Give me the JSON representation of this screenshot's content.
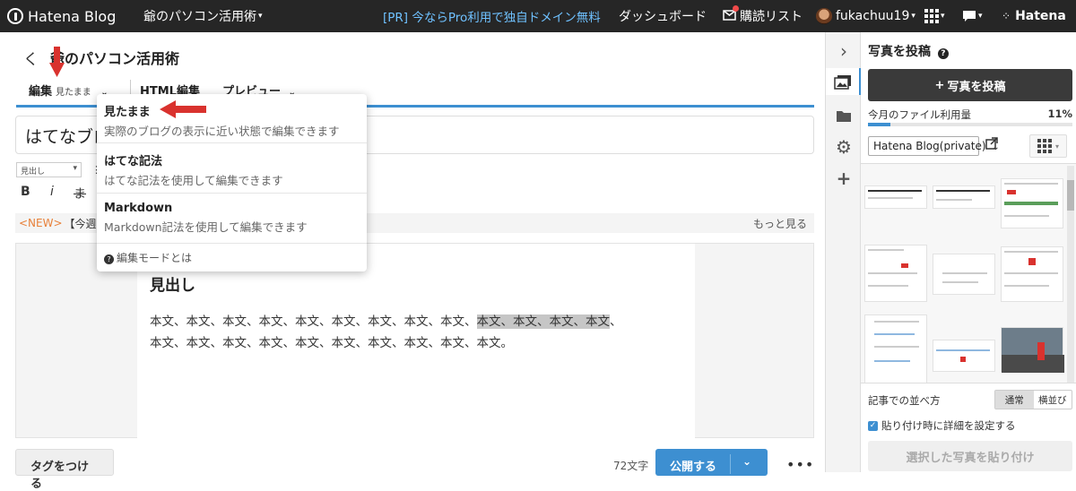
{
  "topbar": {
    "logo": "Hatena Blog",
    "blog_name": "爺のパソコン活用術",
    "pr": "[PR] 今ならPro利用で独自ドメイン無料",
    "dashboard": "ダッシュボード",
    "reading_list": "購読リスト",
    "username": "fukachuu19",
    "hatena": "Hatena",
    "icons": [
      "hatena-logo-icon",
      "reader-icon",
      "avatar",
      "apps-grid-icon",
      "speech-bubble-icon",
      "hatena-star-icon"
    ]
  },
  "editor": {
    "back": "く",
    "blog_title": "爺のパソコン活用術",
    "tabs": {
      "edit": "編集",
      "edit_mode": "見たまま",
      "html": "HTML編集",
      "preview": "プレビュー"
    },
    "title_value": "はてなブロ",
    "toolbar": {
      "style_select": "見出し",
      "bold": "B",
      "italic": "i",
      "strike": "ま"
    },
    "notice": {
      "new_badge": "<NEW>",
      "text": "【今週",
      "more": "もっと見る"
    },
    "content": {
      "heading": "見出し",
      "para_a": "本文、本文、本文、本文、本文、本文、本文、本文、本文、",
      "para_hl": "本文、本文、本文、本文",
      "para_b": "、",
      "para_line2": "本文、本文、本文、本文、本文、本文、本文、本文、本文、本文。"
    },
    "bottom": {
      "tag_button": "タグをつける",
      "char_count": "72文字",
      "publish": "公開する",
      "more": "•••"
    }
  },
  "mode_menu": {
    "items": [
      {
        "title": "見たまま",
        "desc": "実際のブログの表示に近い状態で編集できます"
      },
      {
        "title": "はてな記法",
        "desc": "はてな記法を使用して編集できます"
      },
      {
        "title": "Markdown",
        "desc": "Markdown記法を使用して編集できます"
      }
    ],
    "help": "編集モードとは"
  },
  "side_panel": {
    "title": "写真を投稿",
    "upload_button": "写真を投稿",
    "usage_label": "今月のファイル利用量",
    "usage_percent": "11%",
    "usage_value": 0.11,
    "album": "Hatena Blog(private)",
    "sort_label": "記事での並べ方",
    "sort_options": [
      "通常",
      "横並び"
    ],
    "sort_selected": "通常",
    "detail_checkbox": "貼り付け時に詳細を設定する",
    "detail_checked": true,
    "paste_button": "選択した写真を貼り付け"
  },
  "colors": {
    "topbar_bg": "#262626",
    "accent": "#3d8fd1",
    "pr_link": "#6fc1ff",
    "annotation_arrow": "#d9322e",
    "new_badge": "#e8813a"
  }
}
